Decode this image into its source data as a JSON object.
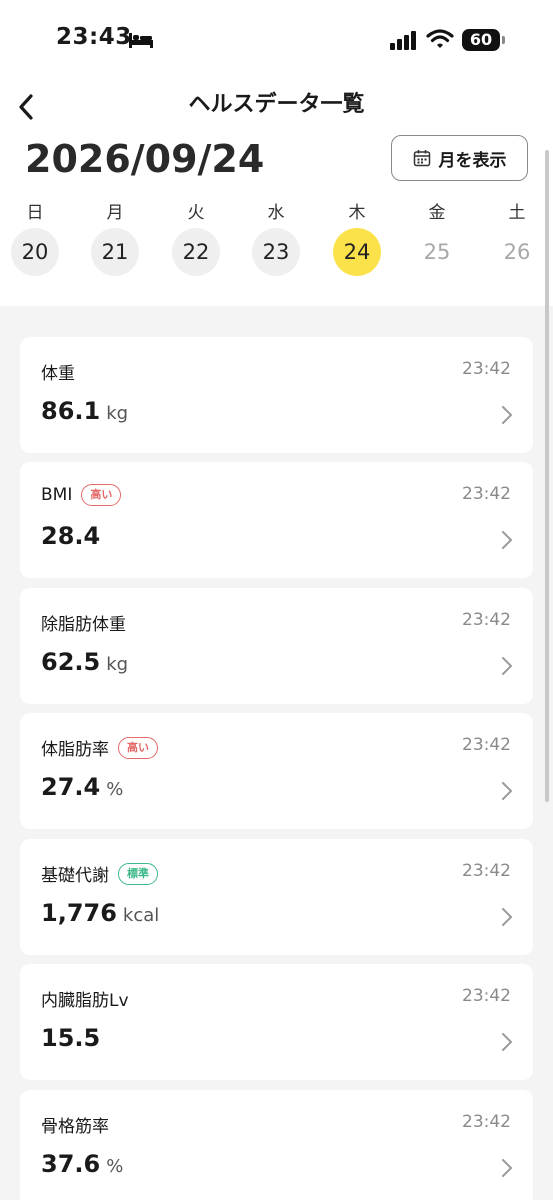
{
  "status_bar": {
    "time": "23:43",
    "battery": "60"
  },
  "header": {
    "title": "ヘルスデータ一覧",
    "date": "2026/09/24",
    "month_button_label": "月を表示"
  },
  "week": [
    {
      "name": "日",
      "num": "20",
      "state": "past"
    },
    {
      "name": "月",
      "num": "21",
      "state": "past"
    },
    {
      "name": "火",
      "num": "22",
      "state": "past"
    },
    {
      "name": "水",
      "num": "23",
      "state": "past"
    },
    {
      "name": "木",
      "num": "24",
      "state": "selected"
    },
    {
      "name": "金",
      "num": "25",
      "state": "future"
    },
    {
      "name": "土",
      "num": "26",
      "state": "future"
    }
  ],
  "metrics": [
    {
      "label": "体重",
      "badge": "",
      "badge_type": "",
      "time": "23:42",
      "value": "86.1",
      "unit": "kg"
    },
    {
      "label": "BMI",
      "badge": "高い",
      "badge_type": "high",
      "time": "23:42",
      "value": "28.4",
      "unit": ""
    },
    {
      "label": "除脂肪体重",
      "badge": "",
      "badge_type": "",
      "time": "23:42",
      "value": "62.5",
      "unit": "kg"
    },
    {
      "label": "体脂肪率",
      "badge": "高い",
      "badge_type": "high",
      "time": "23:42",
      "value": "27.4",
      "unit": "%"
    },
    {
      "label": "基礎代謝",
      "badge": "標準",
      "badge_type": "normal",
      "time": "23:42",
      "value": "1,776",
      "unit": "kcal"
    },
    {
      "label": "内臓脂肪Lv",
      "badge": "",
      "badge_type": "",
      "time": "23:42",
      "value": "15.5",
      "unit": ""
    },
    {
      "label": "骨格筋率",
      "badge": "",
      "badge_type": "",
      "time": "23:42",
      "value": "37.6",
      "unit": "%"
    }
  ],
  "colors": {
    "selected_day": "#fbe24a",
    "badge_high": "#e46a6a",
    "badge_normal": "#3fb98a",
    "list_bg": "#f4f4f4"
  }
}
